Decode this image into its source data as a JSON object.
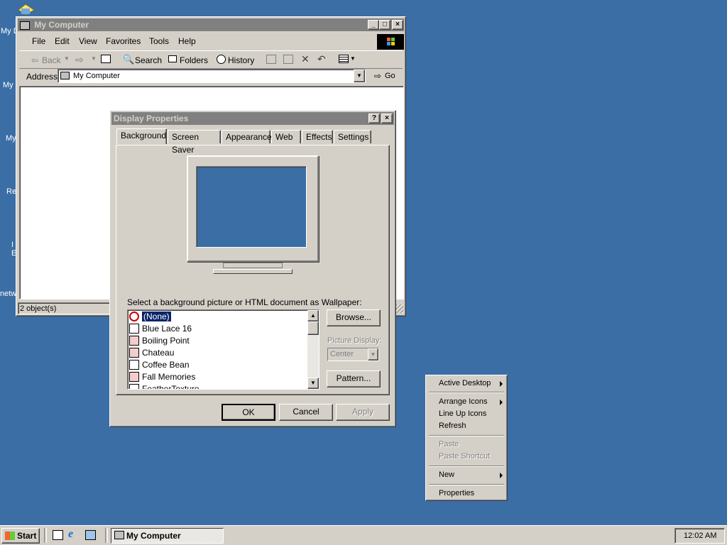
{
  "desktop": {
    "labels": [
      "My D",
      "My",
      "My",
      "Re",
      "I",
      "E",
      "netw"
    ]
  },
  "explorer": {
    "title": "My Computer",
    "menu": [
      "File",
      "Edit",
      "View",
      "Favorites",
      "Tools",
      "Help"
    ],
    "toolbar": {
      "back": "Back",
      "search": "Search",
      "folders": "Folders",
      "history": "History"
    },
    "address_label": "Address",
    "address_value": "My Computer",
    "go_label": "Go",
    "status": "2 object(s)"
  },
  "dialog": {
    "title": "Display Properties",
    "help": "?",
    "close": "×",
    "tabs": [
      "Background",
      "Screen Saver",
      "Appearance",
      "Web",
      "Effects",
      "Settings"
    ],
    "wallpaper_prompt": "Select a background picture or HTML document as Wallpaper:",
    "wallpapers": [
      "(None)",
      "Blue Lace 16",
      "Boiling Point",
      "Chateau",
      "Coffee Bean",
      "Fall Memories",
      "FeatherTexture"
    ],
    "selected_index": 0,
    "browse": "Browse...",
    "picture_display_label": "Picture Display:",
    "picture_display_value": "Center",
    "pattern": "Pattern...",
    "ok": "OK",
    "cancel": "Cancel",
    "apply": "Apply",
    "monitor_color": "#3a6ea5"
  },
  "context_menu": {
    "active_desktop": "Active Desktop",
    "arrange_icons": "Arrange Icons",
    "line_up_icons": "Line Up Icons",
    "refresh": "Refresh",
    "paste": "Paste",
    "paste_shortcut": "Paste Shortcut",
    "new": "New",
    "properties": "Properties"
  },
  "taskbar": {
    "start": "Start",
    "task": "My Computer",
    "clock": "12:02 AM"
  }
}
